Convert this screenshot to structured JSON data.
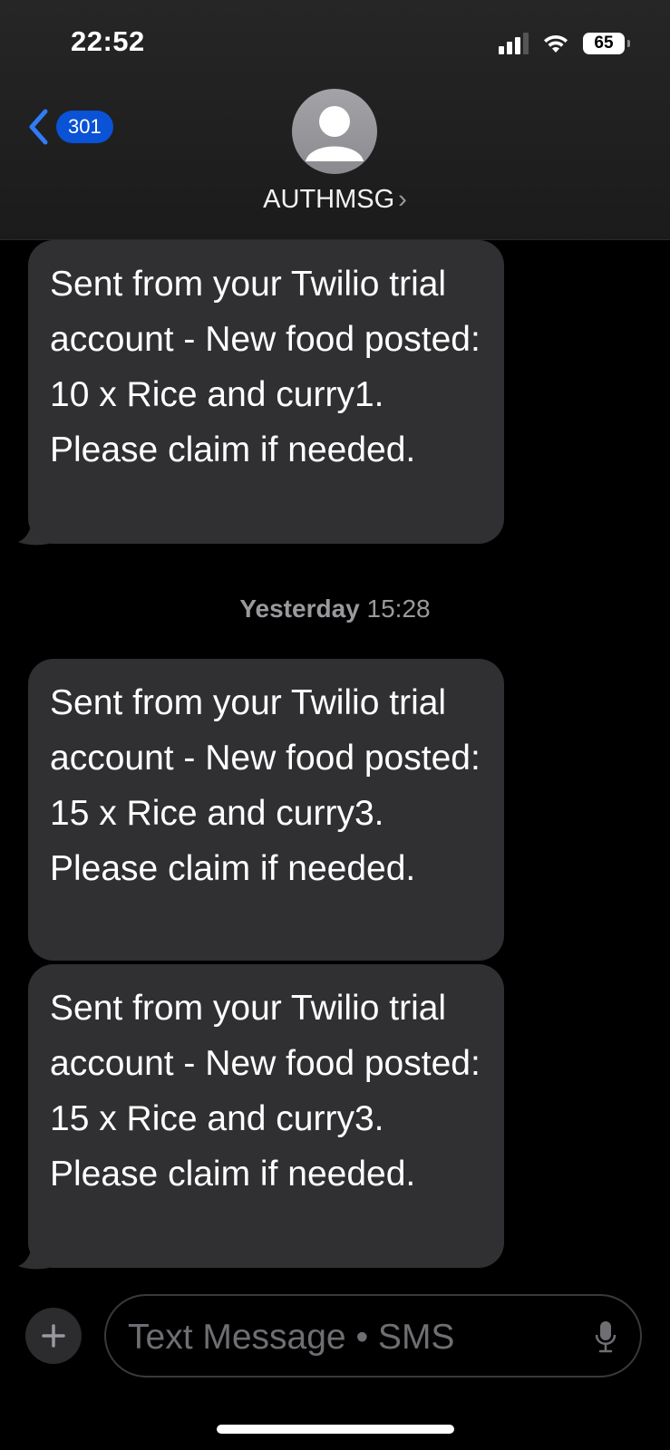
{
  "status_bar": {
    "time": "22:52",
    "battery": "65"
  },
  "header": {
    "back_count": "301",
    "contact_name": "AUTHMSG",
    "chevron": "›"
  },
  "messages": [
    {
      "text": "Sent from your Twilio trial account - New food posted: 10 x Rice and curry1. Please claim if needed."
    },
    {
      "text": "Sent from your Twilio trial account - New food posted: 15 x Rice and curry3. Please claim if needed."
    },
    {
      "text": "Sent from your Twilio trial account - New food posted: 15 x Rice and curry3. Please claim if needed."
    }
  ],
  "timestamp": {
    "day": "Yesterday",
    "time": "15:28"
  },
  "composer": {
    "placeholder": "Text Message • SMS"
  },
  "colors": {
    "accent": "#0a52d6",
    "bubble": "#303032",
    "back_chevron": "#2f7cf6"
  },
  "icons": [
    "back-chevron-icon",
    "person-icon",
    "signal-icon",
    "wifi-icon",
    "battery-icon",
    "plus-icon",
    "microphone-icon"
  ]
}
